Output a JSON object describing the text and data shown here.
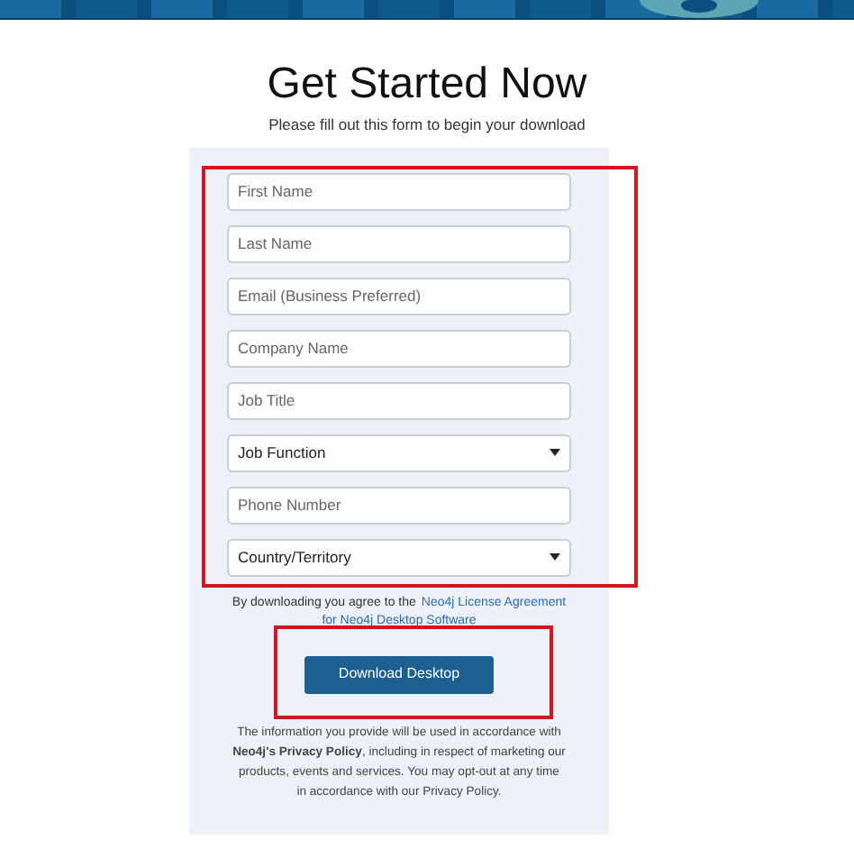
{
  "title": "Get Started Now",
  "subtitle": "Please fill out this form to begin your download",
  "fields": [
    {
      "kind": "text",
      "placeholder": "First Name"
    },
    {
      "kind": "text",
      "placeholder": "Last Name"
    },
    {
      "kind": "text",
      "placeholder": "Email (Business Preferred)"
    },
    {
      "kind": "text",
      "placeholder": "Company Name"
    },
    {
      "kind": "text",
      "placeholder": "Job Title"
    },
    {
      "kind": "select",
      "value": "Job Function"
    },
    {
      "kind": "text",
      "placeholder": "Phone Number"
    },
    {
      "kind": "select",
      "value": "Country/Territory"
    }
  ],
  "agreement": {
    "text": "By downloading you agree to the",
    "link_lines": [
      "Neo4j License Agreement",
      "for Neo4j Desktop Software"
    ]
  },
  "button": "Download Desktop",
  "privacy": "The information you provide will be used in accordance with **Neo4j's Privacy Policy**, including in respect of marketing our products, events and services. You may opt-out at any time in accordance with our Privacy Policy."
}
